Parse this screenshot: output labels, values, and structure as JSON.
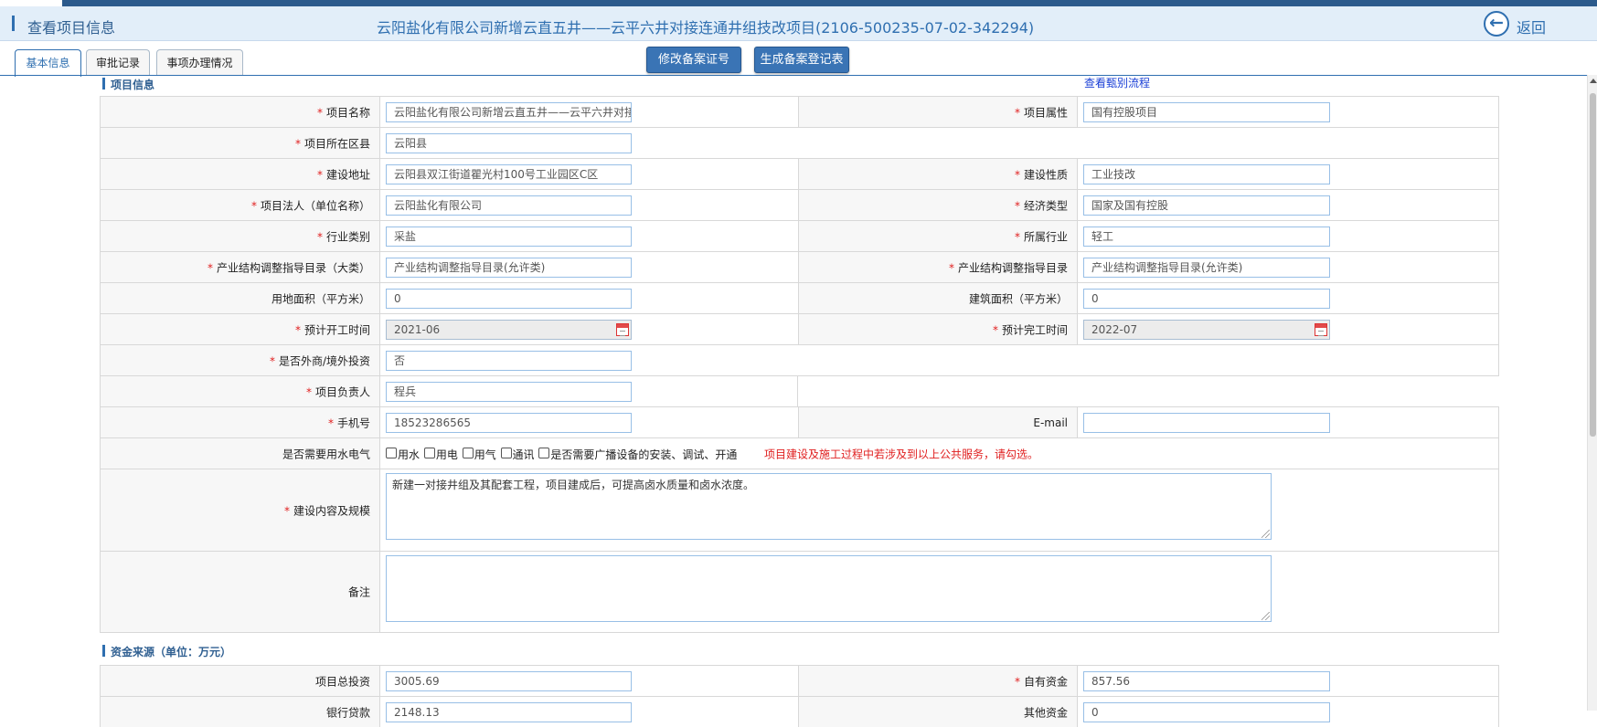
{
  "header": {
    "title": "查看项目信息",
    "project_title": "云阳盐化有限公司新增云直五井——云平六井对接连通井组技改项目(2106-500235-07-02-342294)",
    "back_label": "返回"
  },
  "tabs": [
    {
      "label": "基本信息",
      "active": true
    },
    {
      "label": "审批记录",
      "active": false
    },
    {
      "label": "事项办理情况",
      "active": false
    }
  ],
  "actions": {
    "modify_record_no": "修改备案证号",
    "generate_record_form": "生成备案登记表"
  },
  "project_section": {
    "heading": "项目信息",
    "flow_link": "查看甄别流程"
  },
  "fields": {
    "project_name": {
      "label": "项目名称",
      "value": "云阳盐化有限公司新增云直五井——云平六井对接连通井组技改项目"
    },
    "project_attribute": {
      "label": "项目属性",
      "value": "国有控股项目"
    },
    "district": {
      "label": "项目所在区县",
      "value": "云阳县"
    },
    "address": {
      "label": "建设地址",
      "value": "云阳县双江街道瞿光村100号工业园区C区"
    },
    "build_nature": {
      "label": "建设性质",
      "value": "工业技改"
    },
    "legal_entity": {
      "label": "项目法人（单位名称）",
      "value": "云阳盐化有限公司"
    },
    "economy_type": {
      "label": "经济类型",
      "value": "国家及国有控股"
    },
    "industry_category": {
      "label": "行业类别",
      "value": "采盐"
    },
    "industry": {
      "label": "所属行业",
      "value": "轻工"
    },
    "catalog_major": {
      "label": "产业结构调整指导目录（大类）",
      "value": "产业结构调整指导目录(允许类)"
    },
    "catalog": {
      "label": "产业结构调整指导目录",
      "value": "产业结构调整指导目录(允许类)"
    },
    "land_area": {
      "label": "用地面积（平方米）",
      "value": "0"
    },
    "building_area": {
      "label": "建筑面积（平方米）",
      "value": "0"
    },
    "start_time": {
      "label": "预计开工时间",
      "value": "2021-06"
    },
    "finish_time": {
      "label": "预计完工时间",
      "value": "2022-07"
    },
    "foreign_investment": {
      "label": "是否外商/境外投资",
      "value": "否"
    },
    "manager": {
      "label": "项目负责人",
      "value": "程兵"
    },
    "mobile": {
      "label": "手机号",
      "value": "18523286565"
    },
    "email": {
      "label": "E-mail",
      "value": ""
    },
    "utilities": {
      "label": "是否需要用水电气",
      "options": [
        "用水",
        "用电",
        "用气",
        "通讯",
        "是否需要广播设备的安装、调试、开通"
      ],
      "notice": "项目建设及施工过程中若涉及到以上公共服务，请勾选。"
    },
    "content_scale": {
      "label": "建设内容及规模",
      "value": "新建一对接井组及其配套工程，项目建成后，可提高卤水质量和卤水浓度。"
    },
    "remarks": {
      "label": "备注",
      "value": ""
    }
  },
  "funding_section": {
    "heading": "资金来源（单位：万元）",
    "total_investment": {
      "label": "项目总投资",
      "value": "3005.69"
    },
    "own_funds": {
      "label": "自有资金",
      "value": "857.56"
    },
    "bank_loan": {
      "label": "银行贷款",
      "value": "2148.13"
    },
    "other_funds": {
      "label": "其他资金",
      "value": "0"
    }
  },
  "colors": {
    "accent": "#2f6fb0",
    "required": "#e02020",
    "input_border": "#98bfe6",
    "header_bg": "#e2eef9"
  },
  "icons": {
    "back": "back-arrow-circle-icon",
    "calendar": "calendar-icon"
  }
}
